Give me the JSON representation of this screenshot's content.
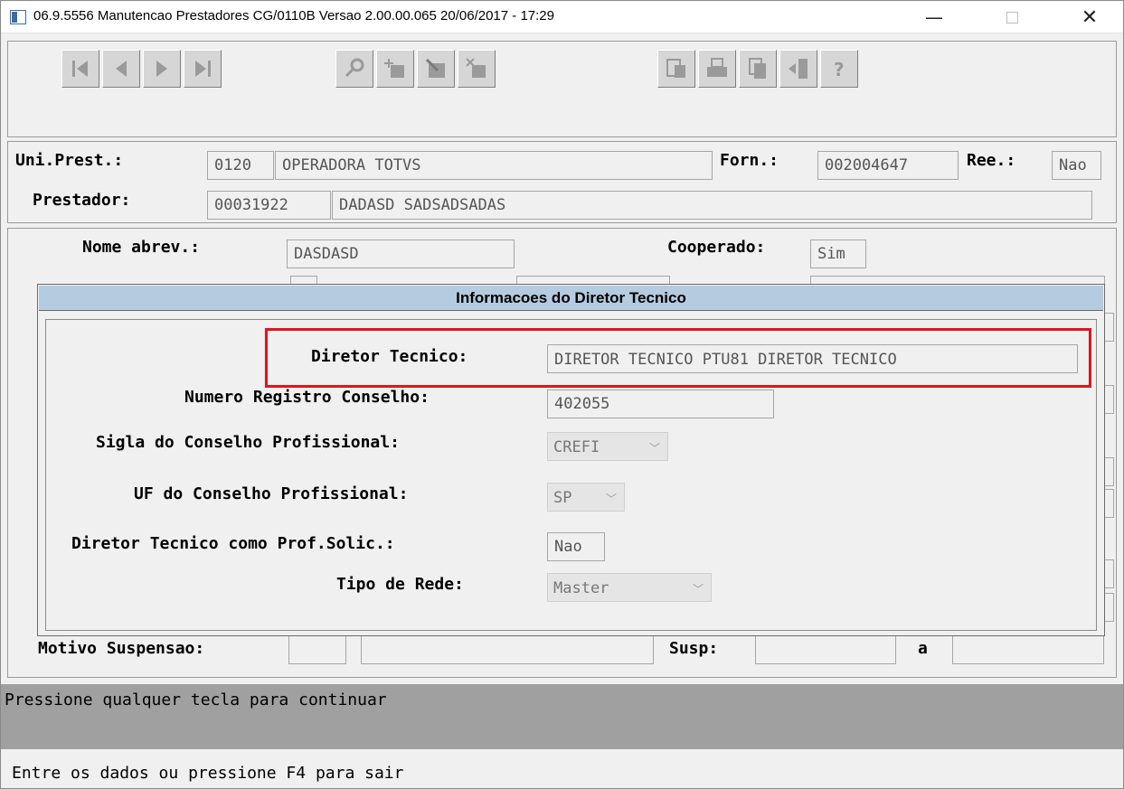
{
  "window": {
    "title": "06.9.5556 Manutencao  Prestadores CG/0110B Versao 2.00.00.065 20/06/2017 - 17:29",
    "minimize": "—",
    "close": "✕"
  },
  "toolbar": {
    "buttons": [
      {
        "name": "first-record",
        "icon": "skip-first-icon"
      },
      {
        "name": "previous-record",
        "icon": "triangle-left-icon"
      },
      {
        "name": "next-record",
        "icon": "triangle-right-icon"
      },
      {
        "name": "last-record",
        "icon": "skip-last-icon"
      },
      {
        "name": "search",
        "icon": "key-icon"
      },
      {
        "name": "add",
        "icon": "add-record-icon"
      },
      {
        "name": "edit",
        "icon": "edit-record-icon"
      },
      {
        "name": "delete",
        "icon": "delete-record-icon"
      },
      {
        "name": "filter",
        "icon": "filter-icon"
      },
      {
        "name": "print",
        "icon": "printer-icon"
      },
      {
        "name": "copy",
        "icon": "copy-icon"
      },
      {
        "name": "exit",
        "icon": "exit-icon"
      },
      {
        "name": "help",
        "icon": "help-icon"
      }
    ]
  },
  "header": {
    "uni_prest_label": "Uni.Prest.:",
    "uni_prest_code": "0120",
    "uni_prest_name": "OPERADORA TOTVS",
    "forn_label": "Forn.:",
    "forn_value": "002004647",
    "ree_label": "Ree.:",
    "ree_value": "Nao",
    "prestador_label": "Prestador:",
    "prestador_code": "00031922",
    "prestador_name": "DADASD SADSADSADAS"
  },
  "form": {
    "nome_abrev_label": "Nome abrev.:",
    "nome_abrev_value": "DASDASD",
    "cooperado_label": "Cooperado:",
    "cooperado_value": "Sim",
    "motivo_suspensao_label": "Motivo Suspensao:",
    "susp_label": "Susp:",
    "a_label": "a"
  },
  "dialog": {
    "title": "Informacoes do Diretor Tecnico",
    "fields": {
      "diretor_tecnico_label": "Diretor Tecnico:",
      "diretor_tecnico_value": "DIRETOR TECNICO PTU81 DIRETOR TECNICO",
      "numero_registro_label": "Numero Registro Conselho:",
      "numero_registro_value": "402055",
      "sigla_conselho_label": "Sigla do Conselho Profissional:",
      "sigla_conselho_value": "CREFI",
      "uf_conselho_label": "UF do Conselho Profissional:",
      "uf_conselho_value": "SP",
      "prof_solic_label": "Diretor Tecnico como Prof.Solic.:",
      "prof_solic_value": "Nao",
      "tipo_rede_label": "Tipo de Rede:",
      "tipo_rede_value": "Master"
    },
    "highlight_color": "#e0141c"
  },
  "status": {
    "message": "Pressione qualquer tecla para continuar",
    "hint": "Entre os dados ou pressione F4 para sair"
  }
}
